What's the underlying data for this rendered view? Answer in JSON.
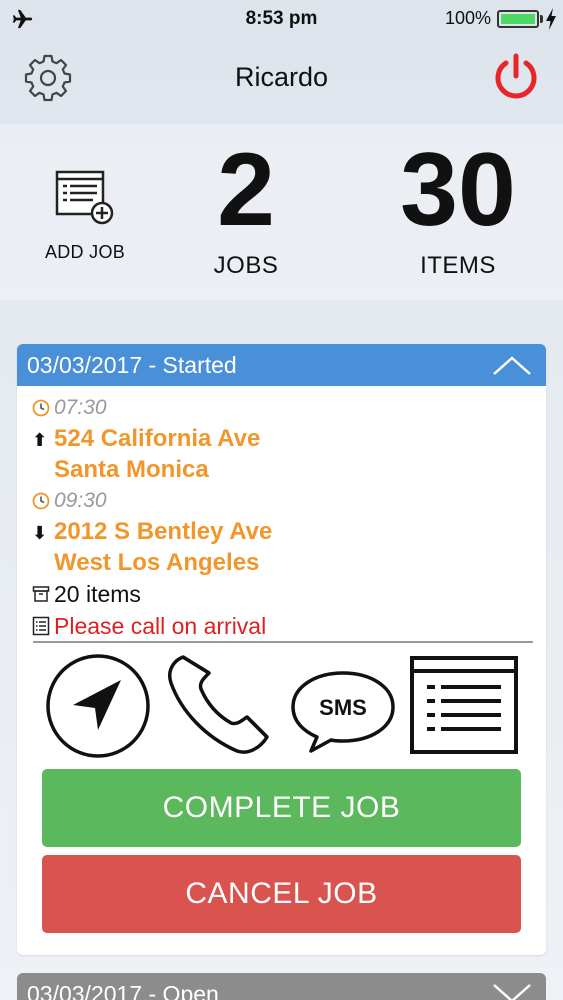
{
  "status_bar": {
    "time": "8:53 pm",
    "battery": "100%",
    "icons": [
      "airplane-icon",
      "battery-icon",
      "charging-bolt-icon"
    ],
    "battery_color": "#4cd964"
  },
  "header": {
    "title": "Ricardo",
    "left_icon": "gear-icon",
    "right_icon": "power-icon",
    "power_color": "#e8262a"
  },
  "stats": {
    "add_job_label": "ADD JOB",
    "jobs": {
      "value": "2",
      "label": "JOBS"
    },
    "items": {
      "value": "30",
      "label": "ITEMS"
    }
  },
  "job_card": {
    "header": "03/03/2017 - Started",
    "header_color": "#4a90d9",
    "pickup": {
      "time": "07:30",
      "address_line1": "524 California Ave",
      "address_line2": "Santa Monica"
    },
    "dropoff": {
      "time": "09:30",
      "address_line1": "2012 S Bentley Ave",
      "address_line2": "West Los Angeles"
    },
    "items": "20 items",
    "note": "Please call on arrival",
    "actions": {
      "navigate_icon": "navigation-arrow-icon",
      "call_icon": "phone-icon",
      "sms_label": "SMS",
      "details_icon": "list-icon"
    },
    "complete_label": "COMPLETE JOB",
    "cancel_label": "CANCEL JOB",
    "colors": {
      "address": "#f0962b",
      "note": "#e02020",
      "complete": "#5cb85c",
      "cancel": "#d9534f"
    }
  },
  "next_card": {
    "header": "03/03/2017 - Open",
    "header_color": "#8c8c8c"
  }
}
